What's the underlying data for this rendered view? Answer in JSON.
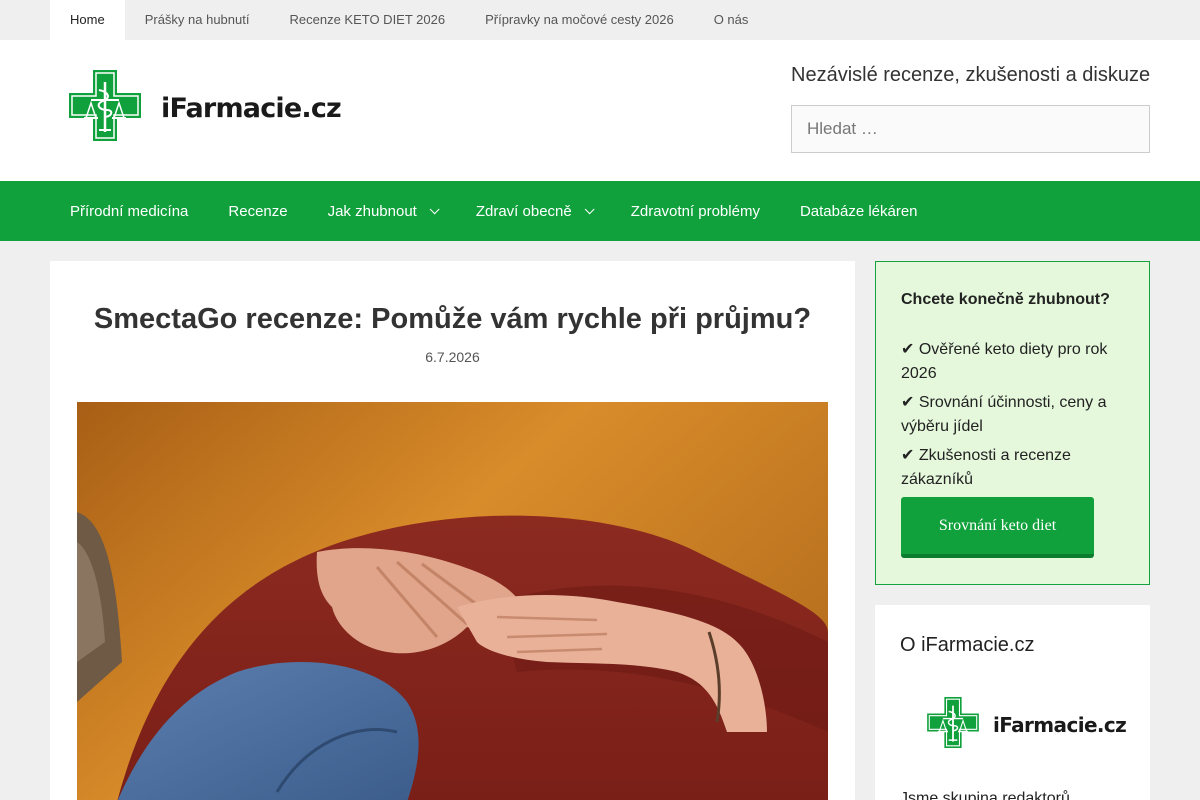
{
  "topnav": {
    "items": [
      {
        "label": "Home"
      },
      {
        "label": "Prášky na hubnutí"
      },
      {
        "label": "Recenze KETO DIET 2026"
      },
      {
        "label": "Přípravky na močové cesty 2026"
      },
      {
        "label": "O nás"
      }
    ]
  },
  "header": {
    "logo_text": "iFarmacie.cz",
    "tagline": "Nezávislé recenze, zkušenosti a diskuze",
    "search_placeholder": "Hledat …"
  },
  "mainnav": {
    "items": [
      {
        "label": "Přírodní medicína"
      },
      {
        "label": "Recenze"
      },
      {
        "label": "Jak zhubnout"
      },
      {
        "label": "Zdraví obecně"
      },
      {
        "label": "Zdravotní problémy"
      },
      {
        "label": "Databáze lékáren"
      }
    ]
  },
  "article": {
    "title": "SmectaGo recenze: Pomůže vám rychle při průjmu?",
    "date": "6.7.2026"
  },
  "promo": {
    "title": "Chcete konečně zhubnout?",
    "items": [
      {
        "text": "✔ Ověřené keto diety pro rok 2026"
      },
      {
        "text": "✔ Srovnání účinnosti, ceny a výběru jídel"
      },
      {
        "text": "✔ Zkušenosti a recenze zákazníků"
      }
    ],
    "button_label": "Srovnání keto diet"
  },
  "about": {
    "title": "O iFarmacie.cz",
    "logo_text": "iFarmacie.cz",
    "text": "Jsme skupina redaktorů"
  },
  "colors": {
    "brand_green": "#10a13c",
    "promo_bg": "#e5f8dc"
  }
}
